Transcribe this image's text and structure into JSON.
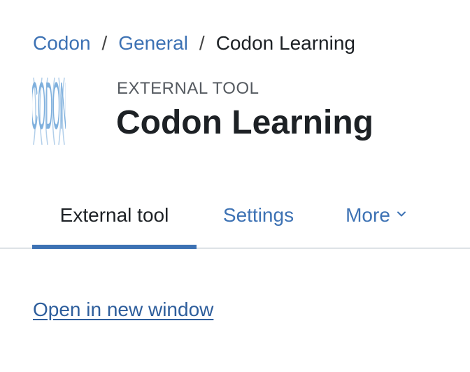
{
  "breadcrumb": {
    "items": [
      "Codon",
      "General"
    ],
    "separator": "/",
    "current": "Codon Learning"
  },
  "header": {
    "logo_text": "CODON",
    "kicker": "EXTERNAL TOOL",
    "title": "Codon Learning"
  },
  "tabs": [
    {
      "label": "External tool",
      "active": true
    },
    {
      "label": "Settings",
      "active": false
    },
    {
      "label": "More",
      "active": false,
      "icon": "chevron-down-icon"
    }
  ],
  "content": {
    "open_link": "Open in new window"
  },
  "colors": {
    "link": "#3d72b4",
    "active_tab_indicator": "#3d72b4",
    "text": "#1d2125",
    "logo": "#7fb0dd"
  }
}
